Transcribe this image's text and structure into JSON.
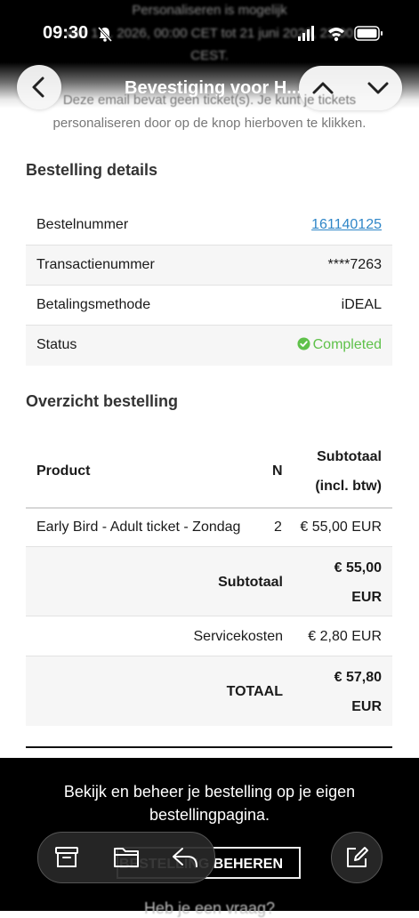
{
  "status_bar": {
    "time": "09:30"
  },
  "banner": {
    "line1": "Personaliseren is mogelijk",
    "line2": "van 1 ... 2026, 00:00 CET tot 21 juni 2026, 23:00",
    "line3": "CEST."
  },
  "nav": {
    "title": "Bevestiging voor H..."
  },
  "intro": {
    "line1": "Deze email bevat geen ticket(s). Je kunt je tickets",
    "line2": "personaliseren door op de knop hierboven te klikken."
  },
  "details": {
    "title": "Bestelling details",
    "rows": [
      {
        "label": "Bestelnummer",
        "value": "161140125"
      },
      {
        "label": "Transactienummer",
        "value": "****7263"
      },
      {
        "label": "Betalingsmethode",
        "value": "iDEAL"
      },
      {
        "label": "Status",
        "value": "Completed"
      }
    ]
  },
  "overview": {
    "title": "Overzicht bestelling",
    "headers": {
      "product": "Product",
      "qty": "N",
      "subtotal_1": "Subtotaal",
      "subtotal_2": "(incl. btw)"
    },
    "item": {
      "product": "Early Bird - Adult ticket - Zondag",
      "qty": "2",
      "price": "€ 55,00 EUR"
    },
    "subtotal": {
      "label": "Subtotaal",
      "value_1": "€ 55,00",
      "value_2": "EUR"
    },
    "service": {
      "label": "Servicekosten",
      "value": "€ 2,80 EUR"
    },
    "total": {
      "label": "TOTAAL",
      "value_1": "€ 57,80",
      "value_2": "EUR"
    }
  },
  "footer": {
    "line1": "Bekijk en beheer je bestelling op je eigen",
    "line2": "bestellingpagina.",
    "button": "BESTELLING BEHEREN",
    "question": "Heb je een vraag?"
  },
  "colors": {
    "link": "#2f86c8",
    "success": "#5fc14a",
    "header_bg": "#000000"
  }
}
